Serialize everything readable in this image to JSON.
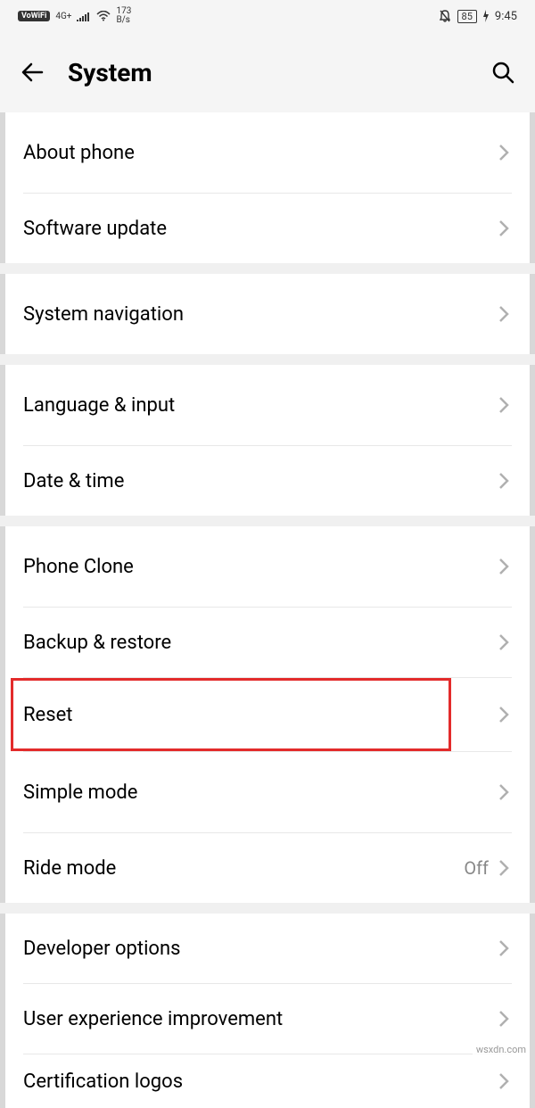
{
  "status": {
    "vowifi": "VoWiFi",
    "network_gen": "4G+",
    "data_rate_num": "173",
    "data_rate_unit": "B/s",
    "battery": "85",
    "time": "9:45"
  },
  "header": {
    "title": "System"
  },
  "sections": [
    {
      "items": [
        {
          "name": "about-phone",
          "label": "About phone",
          "value": null
        },
        {
          "name": "software-update",
          "label": "Software update",
          "value": null
        }
      ]
    },
    {
      "items": [
        {
          "name": "system-navigation",
          "label": "System navigation",
          "value": null
        }
      ]
    },
    {
      "items": [
        {
          "name": "language-input",
          "label": "Language & input",
          "value": null
        },
        {
          "name": "date-time",
          "label": "Date & time",
          "value": null
        }
      ]
    },
    {
      "items": [
        {
          "name": "phone-clone",
          "label": "Phone Clone",
          "value": null
        },
        {
          "name": "backup-restore",
          "label": "Backup & restore",
          "value": null
        },
        {
          "name": "reset",
          "label": "Reset",
          "value": null,
          "highlight": true
        },
        {
          "name": "simple-mode",
          "label": "Simple mode",
          "value": null
        },
        {
          "name": "ride-mode",
          "label": "Ride mode",
          "value": "Off"
        }
      ]
    },
    {
      "items": [
        {
          "name": "developer-options",
          "label": "Developer options",
          "value": null
        },
        {
          "name": "user-experience",
          "label": "User experience improvement",
          "value": null
        },
        {
          "name": "certification-logos",
          "label": "Certification logos",
          "value": null
        }
      ]
    }
  ],
  "watermark": "wsxdn.com"
}
